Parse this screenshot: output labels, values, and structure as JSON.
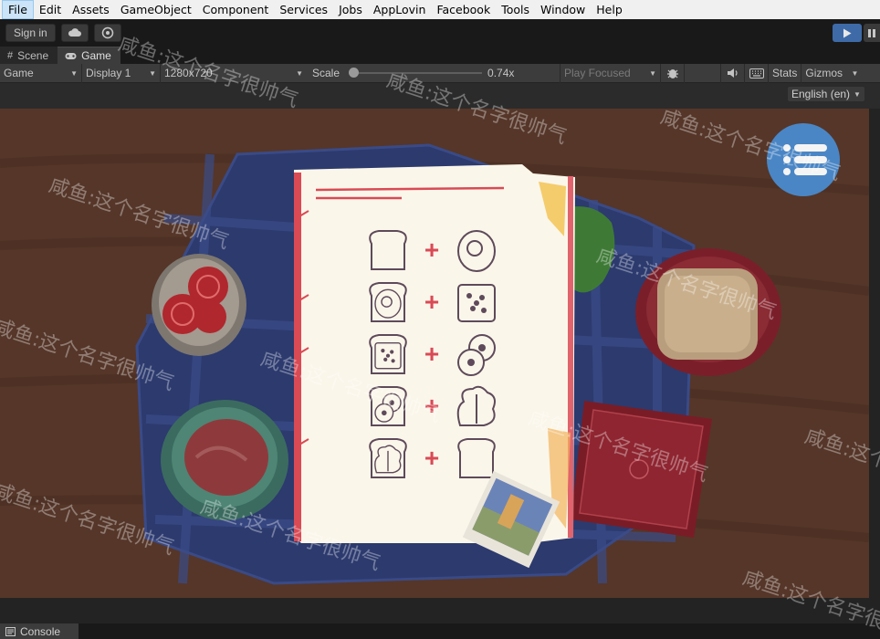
{
  "menubar": {
    "items": [
      "File",
      "Edit",
      "Assets",
      "GameObject",
      "Component",
      "Services",
      "Jobs",
      "AppLovin",
      "Facebook",
      "Tools",
      "Window",
      "Help"
    ]
  },
  "toolbar": {
    "sign_in_label": "Sign in",
    "cloud_icon": "cloud-icon",
    "collab_icon": "collab-icon"
  },
  "tabs": {
    "scene_label": "Scene",
    "game_label": "Game"
  },
  "gamebar": {
    "view_mode": "Game",
    "display": "Display 1",
    "resolution": "1280x720",
    "scale_label": "Scale",
    "scale_value": "0.74x",
    "scale_fraction": 0.0,
    "play_focused": "Play Focused",
    "stats_label": "Stats",
    "gizmos_label": "Gizmos"
  },
  "language": {
    "selected": "English (en)"
  },
  "console": {
    "tab_label": "Console"
  },
  "watermark": "咸鱼:这个名字很帅气",
  "colors": {
    "menubar_bg": "#f0f0f0",
    "editor_bg": "#191919",
    "panel_bg": "#3c3c3c",
    "play_accent": "#3e6ba8",
    "table_wood": "#5a3b2c",
    "tablecloth": "#2b3a70",
    "recipe_paper": "#fbf6ea",
    "recipe_red": "#d94a55",
    "menu_button": "#4a86c5"
  },
  "game": {
    "recipe_rows": [
      {
        "left": "bread-icon",
        "right": "egg-icon"
      },
      {
        "left": "bread-egg-icon",
        "right": "cheese-icon"
      },
      {
        "left": "bread-cheese-icon",
        "right": "lemon-slice-icon"
      },
      {
        "left": "bread-lemon-icon",
        "right": "lettuce-icon"
      },
      {
        "left": "bread-lettuce-icon",
        "right": "bread-icon"
      }
    ],
    "plus_symbol": "+"
  }
}
